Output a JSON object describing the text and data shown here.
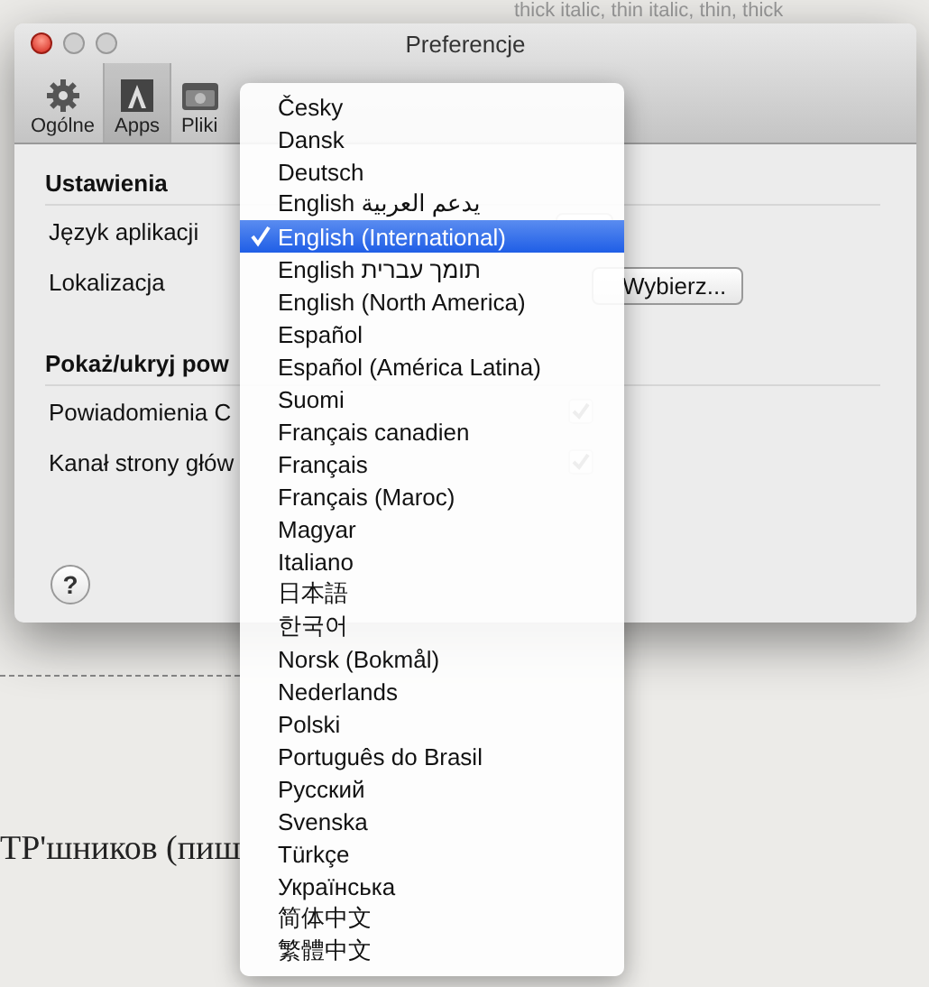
{
  "background": {
    "top_text": "thick italic, thin italic, thin, thick",
    "body_text": "ТР'шников (пиш"
  },
  "window": {
    "title": "Preferencje"
  },
  "tabs": [
    {
      "label": "Ogólne",
      "kind": "gear",
      "selected": false
    },
    {
      "label": "Apps",
      "kind": "apps",
      "selected": true
    },
    {
      "label": "Pliki",
      "kind": "files",
      "selected": false
    }
  ],
  "settings": {
    "heading": "Ustawienia",
    "language_label": "Język aplikacji",
    "location_label": "Lokalizacja",
    "choose_button": "Wybierz..."
  },
  "notifications": {
    "heading": "Pokaż/ukryj pow",
    "rows": [
      {
        "label": "Powiadomienia C",
        "checked": true
      },
      {
        "label": "Kanał strony głów",
        "checked": true
      }
    ]
  },
  "help_button": "?",
  "language_menu": [
    {
      "label": "Česky",
      "selected": false
    },
    {
      "label": "Dansk",
      "selected": false
    },
    {
      "label": "Deutsch",
      "selected": false
    },
    {
      "label": "English يدعم العربية",
      "selected": false
    },
    {
      "label": "English (International)",
      "selected": true
    },
    {
      "label": "English תומך עברית",
      "selected": false
    },
    {
      "label": "English (North America)",
      "selected": false
    },
    {
      "label": "Español",
      "selected": false
    },
    {
      "label": "Español (América Latina)",
      "selected": false
    },
    {
      "label": "Suomi",
      "selected": false
    },
    {
      "label": "Français canadien",
      "selected": false
    },
    {
      "label": "Français",
      "selected": false
    },
    {
      "label": "Français (Maroc)",
      "selected": false
    },
    {
      "label": "Magyar",
      "selected": false
    },
    {
      "label": "Italiano",
      "selected": false
    },
    {
      "label": "日本語",
      "selected": false
    },
    {
      "label": "한국어",
      "selected": false
    },
    {
      "label": "Norsk (Bokmål)",
      "selected": false
    },
    {
      "label": "Nederlands",
      "selected": false
    },
    {
      "label": "Polski",
      "selected": false
    },
    {
      "label": "Português do Brasil",
      "selected": false
    },
    {
      "label": "Русский",
      "selected": false
    },
    {
      "label": "Svenska",
      "selected": false
    },
    {
      "label": "Türkçe",
      "selected": false
    },
    {
      "label": "Українська",
      "selected": false
    },
    {
      "label": "简体中文",
      "selected": false
    },
    {
      "label": "繁體中文",
      "selected": false
    }
  ]
}
